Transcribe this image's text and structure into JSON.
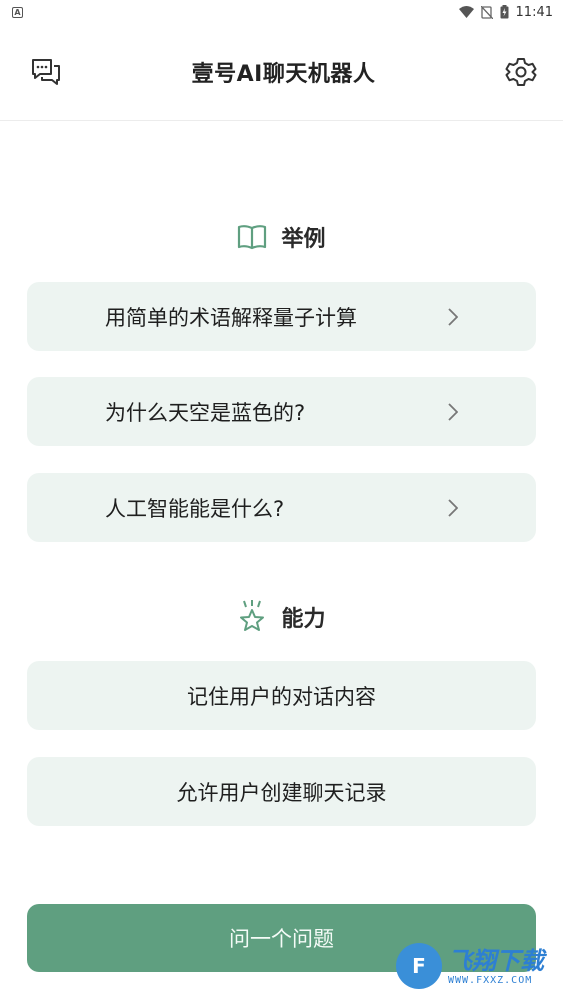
{
  "status_bar": {
    "time": "11:41"
  },
  "header": {
    "title": "壹号AI聊天机器人"
  },
  "examples": {
    "title": "举例",
    "items": [
      {
        "label": "用简单的术语解释量子计算"
      },
      {
        "label": "为什么天空是蓝色的?"
      },
      {
        "label": "人工智能能是什么?"
      }
    ]
  },
  "capabilities": {
    "title": "能力",
    "items": [
      {
        "label": "记住用户的对话内容"
      },
      {
        "label": "允许用户创建聊天记录"
      }
    ]
  },
  "ask_button": {
    "label": "问一个问题"
  },
  "watermark": {
    "text": "飞翔下载",
    "sub": "WWW.FXXZ.COM"
  },
  "colors": {
    "accent": "#5f9f80",
    "card_bg": "#edf4f1",
    "icon_green": "#5f9f80"
  }
}
